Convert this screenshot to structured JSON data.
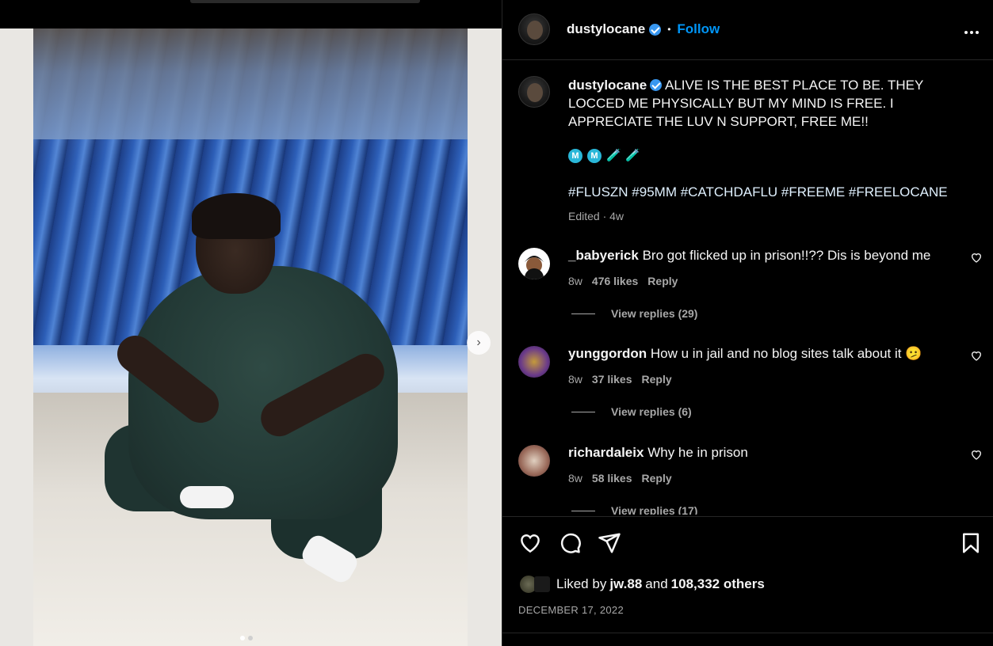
{
  "post": {
    "username": "dustylocane",
    "follow_label": "Follow",
    "separator": "•",
    "more_icon": "more-horizontal-icon",
    "caption_text": "ALIVE IS THE BEST PLACE TO BE. THEY LOCCED ME PHYSICALLY BUT MY MIND IS FREE. I APPRECIATE THE LUV N SUPPORT, FREE ME!!",
    "emoji": [
      "M",
      "M",
      "🧪",
      "🧪"
    ],
    "hashtags": "#FLUSZN #95MM #CATCHDAFLU #FREEME #FREELOCANE",
    "edited": "Edited · 4w"
  },
  "comments": [
    {
      "username": "_babyerick",
      "text": "Bro got flicked up in prison!!?? Dis is beyond me",
      "age": "8w",
      "likes": "476 likes",
      "reply": "Reply",
      "view_replies": "View replies (29)"
    },
    {
      "username": "yunggordon",
      "text": "How u in jail and no blog sites talk about it 🫤",
      "age": "8w",
      "likes": "37 likes",
      "reply": "Reply",
      "view_replies": "View replies (6)"
    },
    {
      "username": "richardaleix",
      "text": "Why he in prison",
      "age": "8w",
      "likes": "58 likes",
      "reply": "Reply",
      "view_replies": "View replies (17)"
    }
  ],
  "footer": {
    "liked_prefix": "Liked by",
    "liked_user": "jw.88",
    "liked_and": "and",
    "liked_others": "108,332 others",
    "date": "DECEMBER 17, 2022"
  },
  "carousel": {
    "total": 2,
    "current": 1
  },
  "colors": {
    "accent": "#0095f6",
    "verified": "#3897f0",
    "background": "#000000",
    "muted": "#a8a8a8"
  }
}
